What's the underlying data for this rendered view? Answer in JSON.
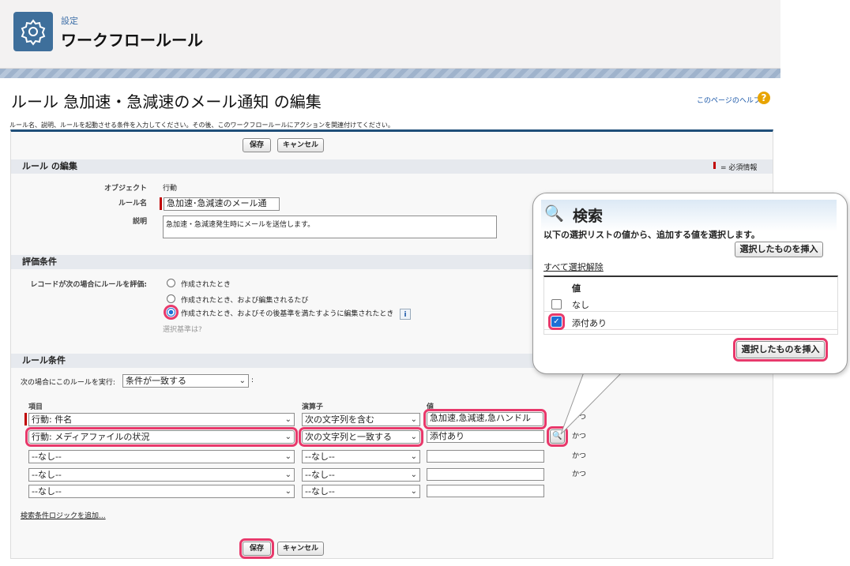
{
  "header": {
    "breadcrumb": "設定",
    "title": "ワークフロールール"
  },
  "page": {
    "title": "ルール 急加速・急減速のメール通知 の編集",
    "help_link": "このページのヘルプ",
    "help_icon": "?",
    "description": "ルール名、説明、ルールを起動させる条件を入力してください。その後、このワークフロールールにアクションを関連付けてください。"
  },
  "buttons": {
    "save": "保存",
    "cancel": "キャンセル"
  },
  "edit_section": {
    "title": "ルール の編集",
    "required_legend": "= 必須情報",
    "object_label": "オブジェクト",
    "object_value": "行動",
    "rule_name_label": "ルール名",
    "rule_name_value": "急加速･急減速のメール通",
    "description_label": "説明",
    "description_value": "急加速・急減速発生時にメールを送信します。"
  },
  "eval_section": {
    "title": "評価条件",
    "label": "レコードが次の場合にルールを評価:",
    "options": [
      "作成されたとき",
      "作成されたとき、および編集されるたび",
      "作成されたとき、およびその後基準を満たすように編集されたとき"
    ],
    "selected_index": 2,
    "criteria_help": "選択基準は?",
    "info_icon": "i"
  },
  "rule_criteria": {
    "title": "ルール条件",
    "run_label": "次の場合にこのルールを実行:",
    "run_value": "条件が一致する",
    "run_suffix": ":",
    "col_field": "項目",
    "col_operator": "演算子",
    "col_value": "値",
    "rows": [
      {
        "field": "行動: 件名",
        "operator": "次の文字列を含む",
        "value": "急加速,急減速,急ハンドル",
        "and": "かつ"
      },
      {
        "field": "行動: メディアファイルの状況",
        "operator": "次の文字列と一致する",
        "value": "添付あり",
        "and": "かつ"
      },
      {
        "field": "--なし--",
        "operator": "--なし--",
        "value": "",
        "and": "かつ"
      },
      {
        "field": "--なし--",
        "operator": "--なし--",
        "value": "",
        "and": "かつ"
      },
      {
        "field": "--なし--",
        "operator": "--なし--",
        "value": "",
        "and": ""
      }
    ],
    "add_logic": "検索条件ロジックを追加..."
  },
  "popup": {
    "title": "検索",
    "description": "以下の選択リストの値から、追加する値を選択します。",
    "insert_button": "選択したものを挿入",
    "clear_all": "すべて選択解除",
    "col_value": "値",
    "items": [
      {
        "label": "なし",
        "checked": false
      },
      {
        "label": "添付あり",
        "checked": true
      }
    ],
    "check_mark": "✓"
  },
  "colors": {
    "header_icon_bg": "#3e6f9b",
    "highlight": "#e8396b",
    "link": "#1a57a8",
    "required": "#c00000",
    "selected_blue": "#1d6fd6"
  }
}
